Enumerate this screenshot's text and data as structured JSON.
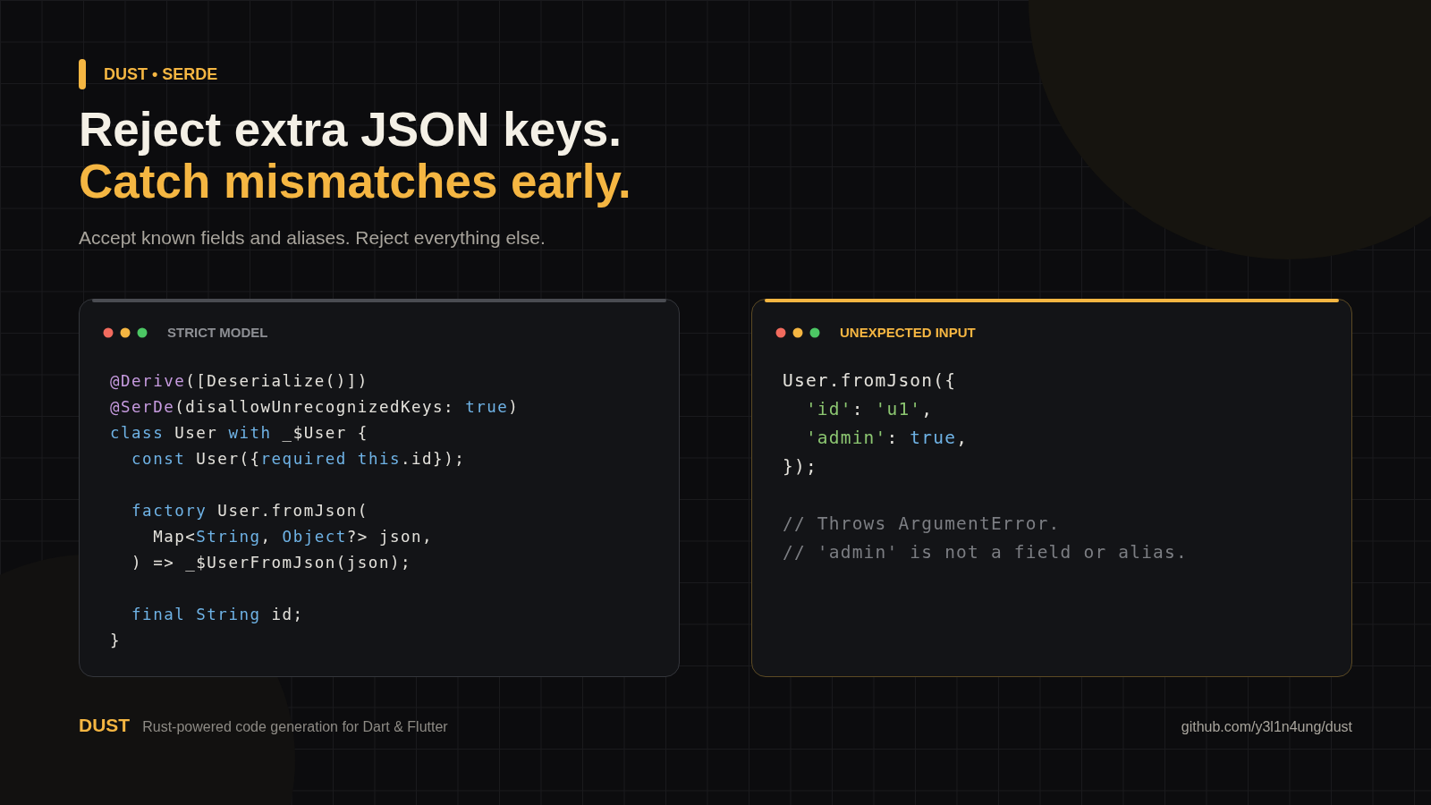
{
  "eyebrow": "DUST • SERDE",
  "headline": {
    "line_1": "Reject extra JSON keys.",
    "line_2": "Catch mismatches early."
  },
  "subtitle": "Accept known fields and aliases. Reject everything else.",
  "cards": [
    {
      "title": "STRICT MODEL",
      "kind": "neutral",
      "blocks": [
        [
          [
            {
              "kind": "annotation",
              "text": "@Derive"
            },
            {
              "kind": "plain",
              "text": "([Deserialize()])"
            }
          ],
          [
            {
              "kind": "annotation",
              "text": "@SerDe"
            },
            {
              "kind": "plain",
              "text": "(disallowUnrecognizedKeys: "
            },
            {
              "kind": "keyword",
              "text": "true"
            },
            {
              "kind": "plain",
              "text": ")"
            }
          ],
          [
            {
              "kind": "keyword",
              "text": "class"
            },
            {
              "kind": "plain",
              "text": " User "
            },
            {
              "kind": "keyword",
              "text": "with"
            },
            {
              "kind": "plain",
              "text": " _$User {"
            }
          ],
          [
            {
              "kind": "keyword",
              "text": "  const"
            },
            {
              "kind": "plain",
              "text": " User({"
            },
            {
              "kind": "keyword",
              "text": "required this"
            },
            {
              "kind": "plain",
              "text": ".id});"
            }
          ]
        ],
        [
          [
            {
              "kind": "keyword",
              "text": "  factory"
            },
            {
              "kind": "plain",
              "text": " User.fromJson("
            }
          ],
          [
            {
              "kind": "plain",
              "text": "    Map<"
            },
            {
              "kind": "keyword",
              "text": "String"
            },
            {
              "kind": "plain",
              "text": ", "
            },
            {
              "kind": "keyword",
              "text": "Object"
            },
            {
              "kind": "plain",
              "text": "?> json,"
            }
          ],
          [
            {
              "kind": "plain",
              "text": "  ) => _$UserFromJson(json);"
            }
          ]
        ],
        [
          [
            {
              "kind": "keyword",
              "text": "  final String"
            },
            {
              "kind": "plain",
              "text": " id;"
            }
          ],
          [
            {
              "kind": "plain",
              "text": "}"
            }
          ]
        ]
      ]
    },
    {
      "title": "UNEXPECTED INPUT",
      "kind": "warning",
      "blocks": [
        [
          [
            {
              "kind": "plain",
              "text": "User.fromJson({"
            }
          ],
          [
            {
              "kind": "string",
              "text": "  'id'"
            },
            {
              "kind": "plain",
              "text": ": "
            },
            {
              "kind": "string",
              "text": "'u1'"
            },
            {
              "kind": "plain",
              "text": ","
            }
          ],
          [
            {
              "kind": "string",
              "text": "  'admin'"
            },
            {
              "kind": "plain",
              "text": ": "
            },
            {
              "kind": "keyword",
              "text": "true"
            },
            {
              "kind": "plain",
              "text": ","
            }
          ],
          [
            {
              "kind": "plain",
              "text": "});"
            }
          ]
        ],
        [
          [
            {
              "kind": "comment",
              "text": "// Throws ArgumentError."
            }
          ],
          [
            {
              "kind": "comment",
              "text": "// 'admin' is not a field or alias."
            }
          ]
        ]
      ]
    }
  ],
  "footer": {
    "brand": "DUST",
    "tagline": "Rust-powered code generation for Dart & Flutter",
    "link": "github.com/y3l1n4ung/dust"
  }
}
